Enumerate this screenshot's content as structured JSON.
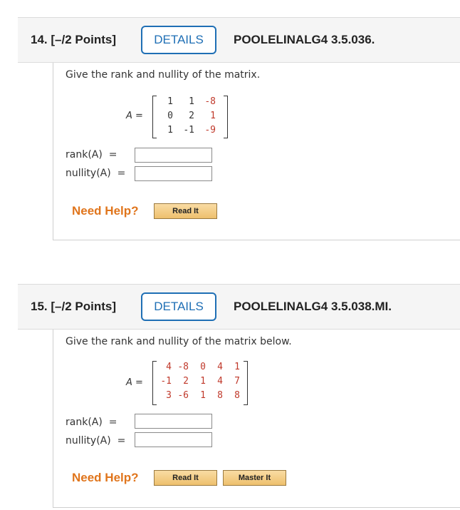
{
  "questions": [
    {
      "number": "14.  [–/2 Points]",
      "details": "DETAILS",
      "code": "POOLELINALG4 3.5.036.",
      "prompt": "Give the rank and nullity of the matrix.",
      "matrix_label": "A",
      "matrix": [
        [
          "1",
          "1",
          "-8"
        ],
        [
          "0",
          "2",
          "1"
        ],
        [
          "1",
          "-1",
          "-9"
        ]
      ],
      "rank_label": "rank(A)",
      "nullity_label": "nullity(A)",
      "equals": "=",
      "rank_value": "",
      "nullity_value": "",
      "help": "Need Help?",
      "buttons": [
        "Read It"
      ]
    },
    {
      "number": "15.  [–/2 Points]",
      "details": "DETAILS",
      "code": "POOLELINALG4 3.5.038.MI.",
      "prompt": "Give the rank and nullity of the matrix below.",
      "matrix_label": "A",
      "matrix": [
        [
          "4",
          "-8",
          "0",
          "4",
          "1"
        ],
        [
          "-1",
          "2",
          "1",
          "4",
          "7"
        ],
        [
          "3",
          "-6",
          "1",
          "8",
          "8"
        ]
      ],
      "rank_label": "rank(A)",
      "nullity_label": "nullity(A)",
      "equals": "=",
      "rank_value": "",
      "nullity_value": "",
      "help": "Need Help?",
      "buttons": [
        "Read It",
        "Master It"
      ]
    }
  ],
  "colors": {
    "accent_blue": "#1f6fb5",
    "help_orange": "#e0751c",
    "matrix_red": "#c0392b",
    "header_bg": "#f5f5f5"
  }
}
